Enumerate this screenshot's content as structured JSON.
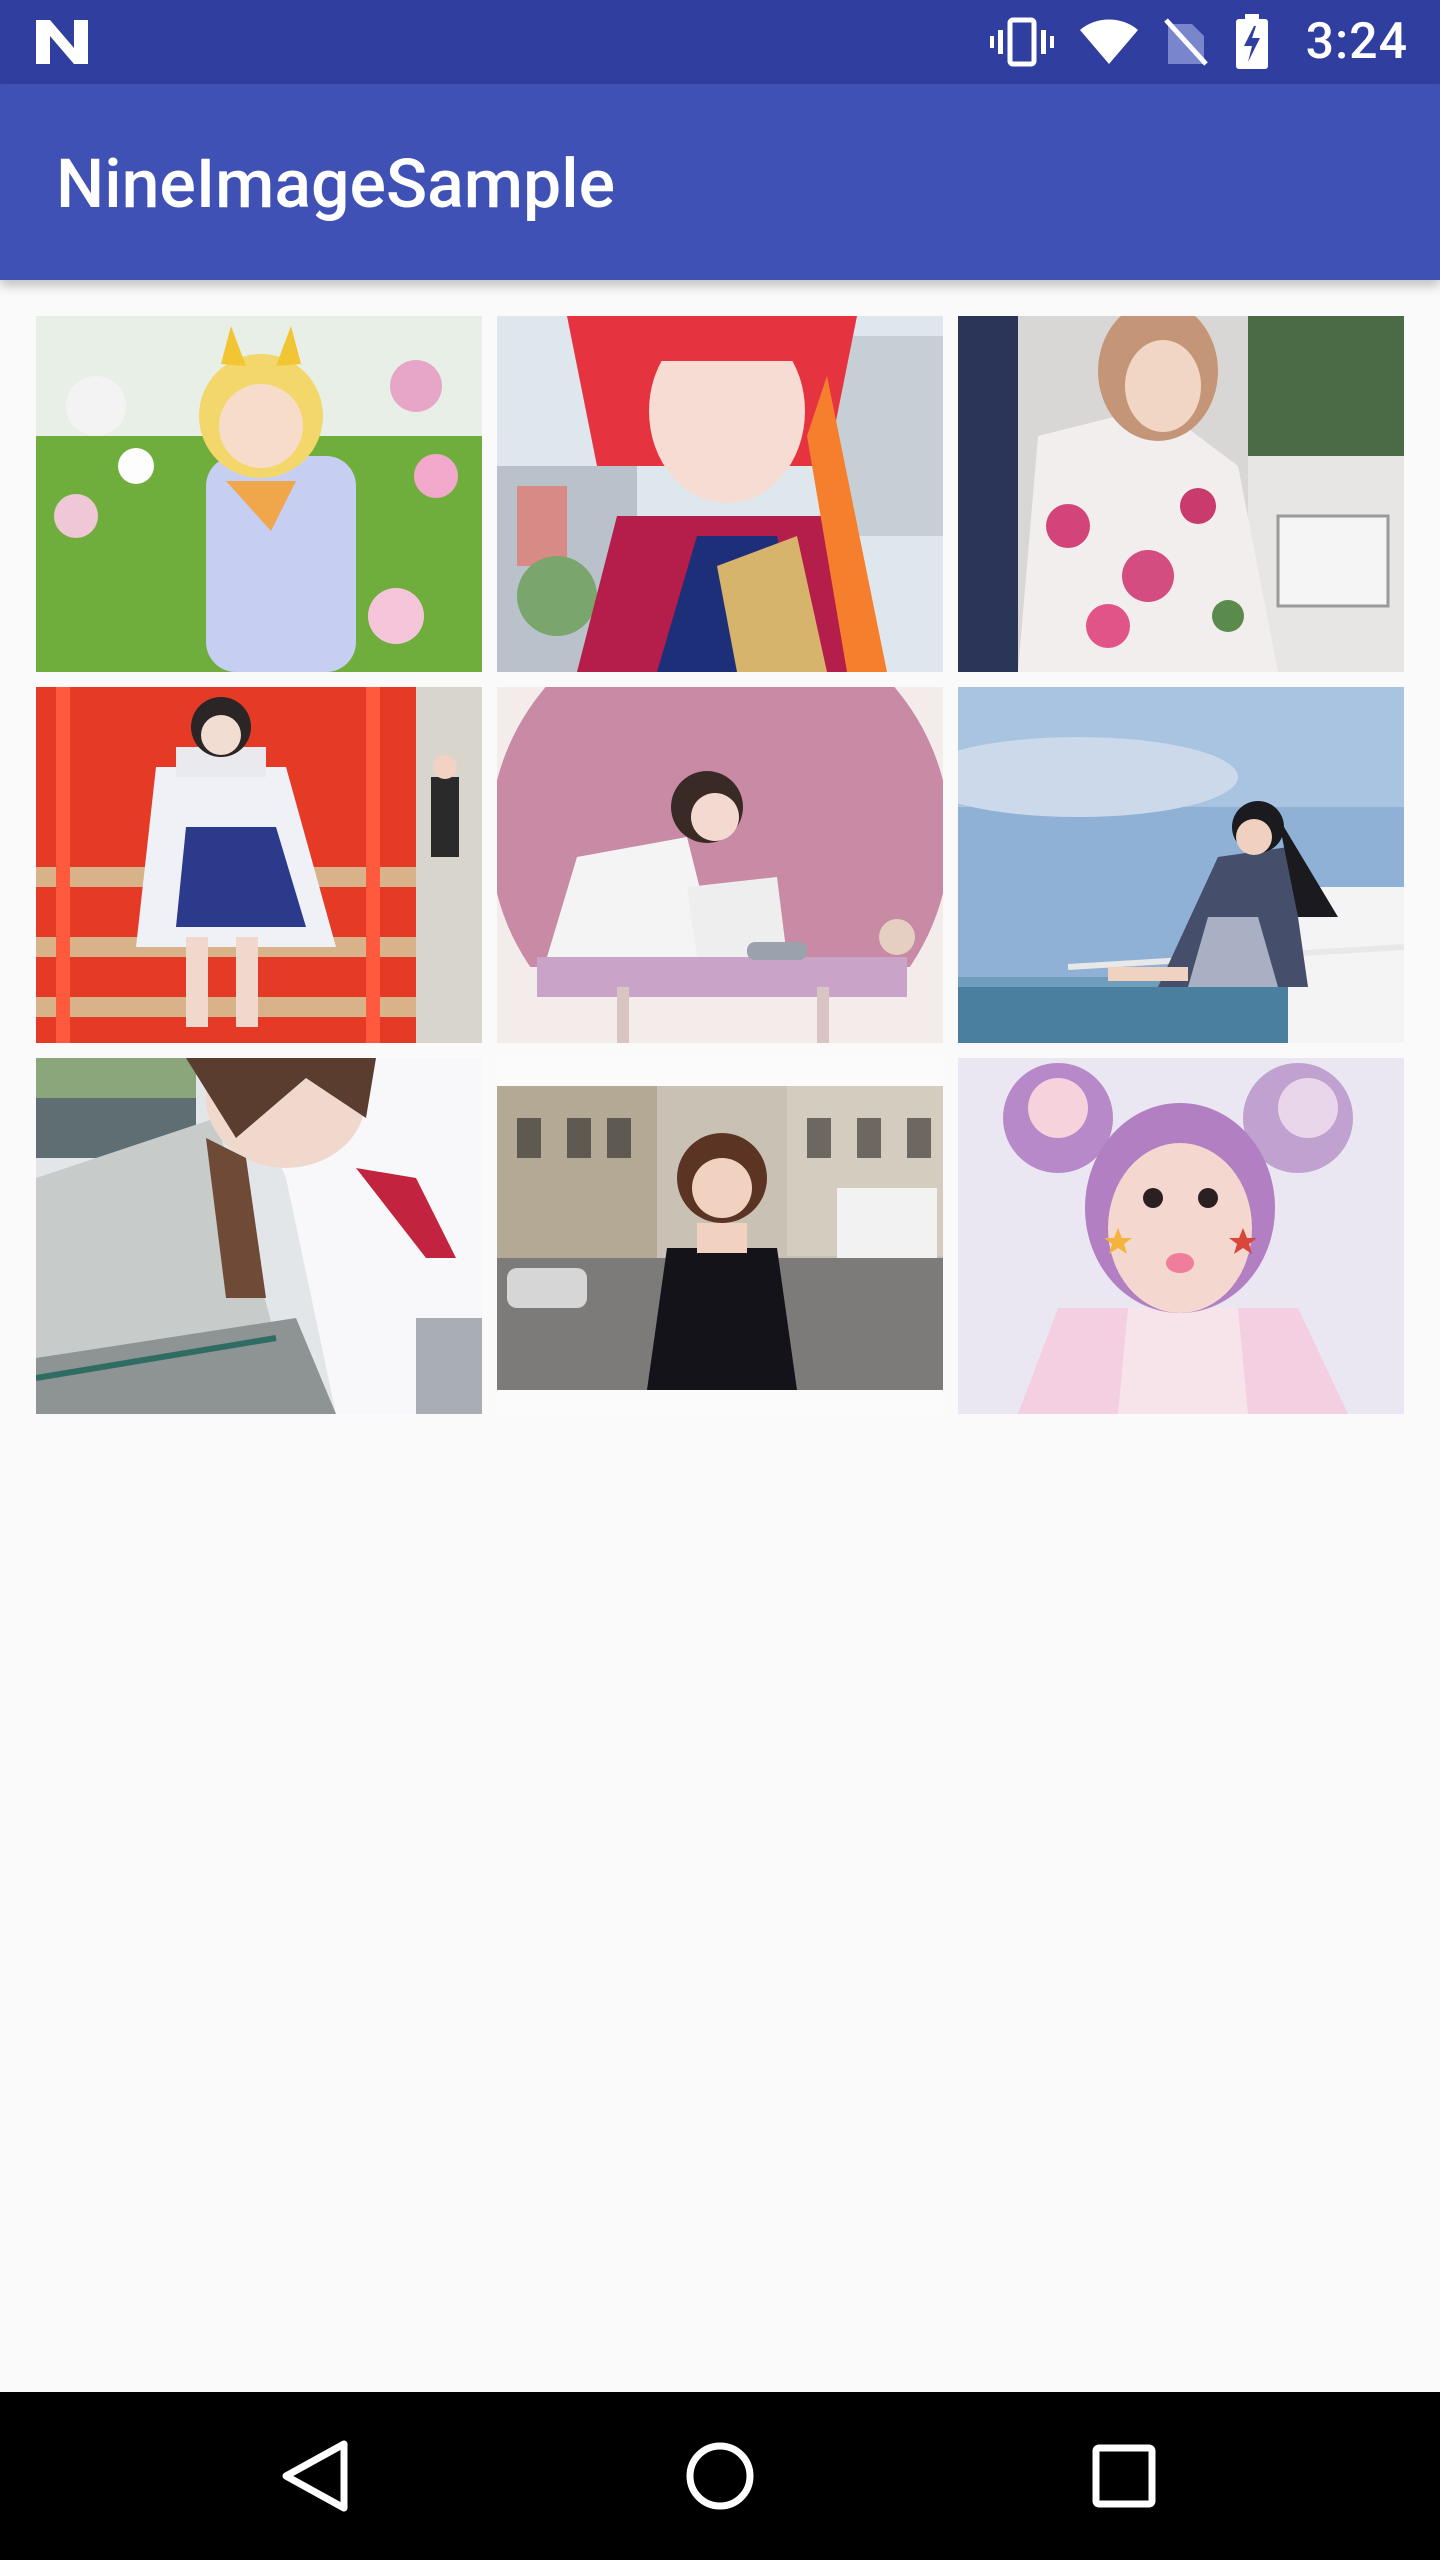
{
  "status_bar": {
    "time": "3:24",
    "icons": [
      "n-logo-icon",
      "vibrate-icon",
      "wifi-icon",
      "no-sim-icon",
      "battery-charging-icon"
    ]
  },
  "app_bar": {
    "title": "NineImageSample"
  },
  "grid": {
    "tiles": [
      {
        "name": "photo-tile-1",
        "image": "cosplay-girl-in-flower-garden-photo"
      },
      {
        "name": "photo-tile-2",
        "image": "red-haired-cosplay-selfie-photo"
      },
      {
        "name": "photo-tile-3",
        "image": "woman-in-floral-dress-on-train-photo"
      },
      {
        "name": "photo-tile-4",
        "image": "kimono-cosplay-on-red-stairs-photo"
      },
      {
        "name": "photo-tile-5",
        "image": "girl-sitting-in-pink-round-alcove-photo"
      },
      {
        "name": "photo-tile-6",
        "image": "woman-sitting-on-boat-railing-photo"
      },
      {
        "name": "photo-tile-7",
        "image": "schoolgirl-uniform-selfie-photo"
      },
      {
        "name": "photo-tile-8",
        "image": "woman-in-black-dress-paris-street-photo"
      },
      {
        "name": "photo-tile-9",
        "image": "girl-with-purple-buns-and-star-stickers-photo"
      }
    ]
  },
  "nav_bar": {
    "buttons": [
      "back-icon",
      "home-icon",
      "recents-icon"
    ]
  }
}
